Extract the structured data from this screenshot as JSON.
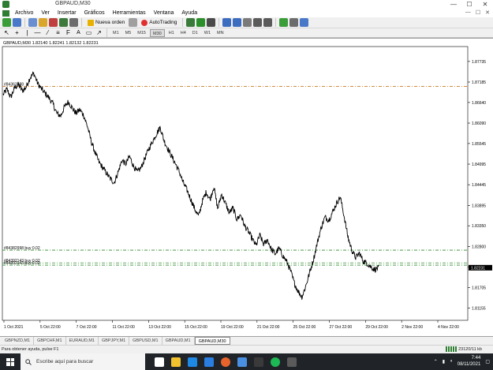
{
  "window": {
    "title": "GBPAUD,M30",
    "controls": [
      "—",
      "☐",
      "✕"
    ]
  },
  "menu": {
    "items": [
      "Archivo",
      "Ver",
      "Insertar",
      "Gráficos",
      "Herramientas",
      "Ventana",
      "Ayuda"
    ],
    "window_controls": [
      "—",
      "☐",
      "✕"
    ]
  },
  "toolbar": {
    "new_order_label": "Nueva orden",
    "autotrading_label": "AutoTrading"
  },
  "timeframes": [
    "M1",
    "M5",
    "M15",
    "M30",
    "H1",
    "H4",
    "D1",
    "W1",
    "MN"
  ],
  "active_timeframe": "M30",
  "chart": {
    "header": "GBPAUD,M30  1.82140 1.82241 1.82132 1.82231",
    "order_labels": {
      "top": "#84363388",
      "buy1": "#84382998 buy 0.02",
      "buy2": "#84392143 buy 0.02",
      "buy3": "#84392143 buy 0.02"
    },
    "current_price_label": "1.82231"
  },
  "chart_data": {
    "type": "line",
    "symbol": "GBPAUD",
    "timeframe": "M30",
    "ohlc_header": {
      "open": 1.8214,
      "high": 1.82241,
      "low": 1.82132,
      "close": 1.82231
    },
    "x_ticks": [
      "1 Oct 2021",
      "5 Oct 22:00",
      "7 Oct 22:00",
      "11 Oct 22:00",
      "13 Oct 22:00",
      "15 Oct 22:00",
      "19 Oct 22:00",
      "21 Oct 22:00",
      "25 Oct 22:00",
      "27 Oct 22:00",
      "29 Oct 22:00",
      "2 Nov 22:00",
      "4 Nov 22:00"
    ],
    "y_ticks": [
      1.87735,
      1.87185,
      1.8664,
      1.8609,
      1.85545,
      1.84995,
      1.84445,
      1.83895,
      1.8335,
      1.828,
      1.82255,
      1.81705,
      1.81155
    ],
    "ylim": [
      1.8087,
      1.8809
    ],
    "price_series": [
      1.8685,
      1.8699,
      1.8678,
      1.8703,
      1.8712,
      1.8695,
      1.8705,
      1.873,
      1.8742,
      1.8715,
      1.87,
      1.8688,
      1.8676,
      1.866,
      1.8635,
      1.8628,
      1.8652,
      1.8666,
      1.865,
      1.8635,
      1.8645,
      1.863,
      1.86,
      1.856,
      1.853,
      1.8505,
      1.849,
      1.8475,
      1.846,
      1.845,
      1.8478,
      1.851,
      1.85,
      1.852,
      1.8495,
      1.8478,
      1.849,
      1.8515,
      1.854,
      1.856,
      1.858,
      1.8598,
      1.8562,
      1.854,
      1.852,
      1.85,
      1.8478,
      1.845,
      1.843,
      1.8405,
      1.838,
      1.836,
      1.84,
      1.8425,
      1.8405,
      1.844,
      1.838,
      1.842,
      1.8395,
      1.837,
      1.8382,
      1.8352,
      1.8365,
      1.8335,
      1.832,
      1.83,
      1.8282,
      1.831,
      1.8285,
      1.8298,
      1.8272,
      1.826,
      1.8275,
      1.8255,
      1.824,
      1.8215,
      1.8182,
      1.816,
      1.8145,
      1.8175,
      1.821,
      1.8245,
      1.829,
      1.833,
      1.8358,
      1.835,
      1.8372,
      1.8395,
      1.8412,
      1.836,
      1.8305,
      1.827,
      1.825,
      1.8262,
      1.824,
      1.8235,
      1.8225,
      1.8218,
      1.8223
    ],
    "horizontal_lines": [
      {
        "label": "#84363388",
        "value": 1.8707,
        "color": "#cc7a2a"
      },
      {
        "label": "#84382998 buy 0.02",
        "value": 1.827,
        "color": "#2e8b2e"
      },
      {
        "label": "#84392143 buy 0.02",
        "value": 1.8236,
        "color": "#2e8b2e"
      },
      {
        "label": "#84392143 buy 0.02",
        "value": 1.823,
        "color": "#2e8b2e"
      }
    ],
    "current_price": 1.82231,
    "grid": false
  },
  "chart_tabs": [
    "GBPNZD,M1",
    "GBPCHF,M1",
    "EURAUD,M1",
    "GBPJPY,M1",
    "GBPUSD,M1",
    "GBPAUD,M1",
    "GBPAUD,M30"
  ],
  "active_chart_tab": "GBPAUD,M30",
  "statusbar": {
    "help": "Para obtener ayuda, pulse F1",
    "traffic": "23120/11 kb"
  },
  "taskbar": {
    "search_placeholder": "Escribe aquí para buscar",
    "time": "7:44",
    "date": "08/11/2021"
  },
  "colors": {
    "chart_line": "#000000",
    "order_line_sell": "#cc7a2a",
    "order_line_buy": "#2e8b2e",
    "current_price_bg": "#000000"
  }
}
